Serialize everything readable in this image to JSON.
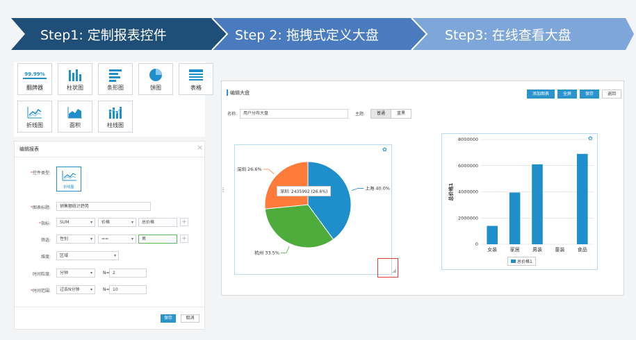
{
  "steps": [
    {
      "label": "Step1: 定制报表控件",
      "color": "#1f4e79"
    },
    {
      "label": "Step 2: 拖拽式定义大盘",
      "color": "#4a7bbf"
    },
    {
      "label": "Step3: 在线查看大盘",
      "color": "#7ea6d8"
    }
  ],
  "palette": [
    {
      "label": "翻牌器",
      "icon": "flip-counter-icon",
      "badge": "99.99%"
    },
    {
      "label": "柱状图",
      "icon": "bar-chart-icon"
    },
    {
      "label": "条形图",
      "icon": "horizontal-bar-icon"
    },
    {
      "label": "饼图",
      "icon": "pie-chart-icon"
    },
    {
      "label": "表格",
      "icon": "table-icon"
    },
    {
      "label": "折线图",
      "icon": "line-chart-icon"
    },
    {
      "label": "面积",
      "icon": "area-chart-icon"
    },
    {
      "label": "柱线图",
      "icon": "bar-line-chart-icon"
    }
  ],
  "form": {
    "title": "编辑报表",
    "close": "×",
    "widget_type_label": "控件类型:",
    "widget_type_value": "折线图",
    "chart_title_label": "图表标题:",
    "chart_title_value": "销售额统计趋势",
    "metric_label": "指标:",
    "metric_agg": "SUM",
    "metric_field": "价格",
    "metric_alias": "总价格",
    "filter_label": "筛选:",
    "filter_field": "性别",
    "filter_op": "==",
    "filter_value": "男",
    "dimension_label": "维度:",
    "dimension_value": "区域",
    "granularity_label": "时间粒度:",
    "granularity_value": "分钟",
    "granularity_n_label": "N=",
    "granularity_n": "2",
    "range_label": "时间范围:",
    "range_value": "过去N分钟",
    "range_n_label": "N=",
    "range_n": "10",
    "save": "保存",
    "cancel": "取消"
  },
  "dashboard": {
    "title": "编辑大盘",
    "buttons": {
      "add": "添加图表",
      "fullscreen": "全屏",
      "save": "保存",
      "back": "返回"
    },
    "name_label": "名称:",
    "name_value": "用户分布大盘",
    "theme_label": "主题:",
    "theme_options": [
      "普通",
      "蓝黑"
    ]
  },
  "accent": "#2b94cc",
  "chart_data": [
    {
      "type": "pie",
      "slices": [
        {
          "name": "上海",
          "label": "上海 40.0%",
          "value": 40.0,
          "color": "#1e8fca"
        },
        {
          "name": "杭州",
          "label": "杭州 33.5%",
          "value": 33.5,
          "color": "#4eac3c"
        },
        {
          "name": "深圳",
          "label": "深圳 26.6%",
          "value": 26.6,
          "color": "#ff7b3a"
        }
      ],
      "tooltip": "深圳: 2435992 (26.6%)"
    },
    {
      "type": "bar",
      "categories": [
        "女装",
        "家居",
        "男装",
        "童装",
        "食品"
      ],
      "values": [
        1400000,
        3950000,
        6100000,
        0,
        6900000
      ],
      "ylabel": "总价格1",
      "ylim": [
        0,
        8000000
      ],
      "yticks": [
        "0",
        "2000000",
        "4000000",
        "6000000",
        "8000000"
      ],
      "legend": "总价格1",
      "color": "#1e8fca"
    }
  ]
}
